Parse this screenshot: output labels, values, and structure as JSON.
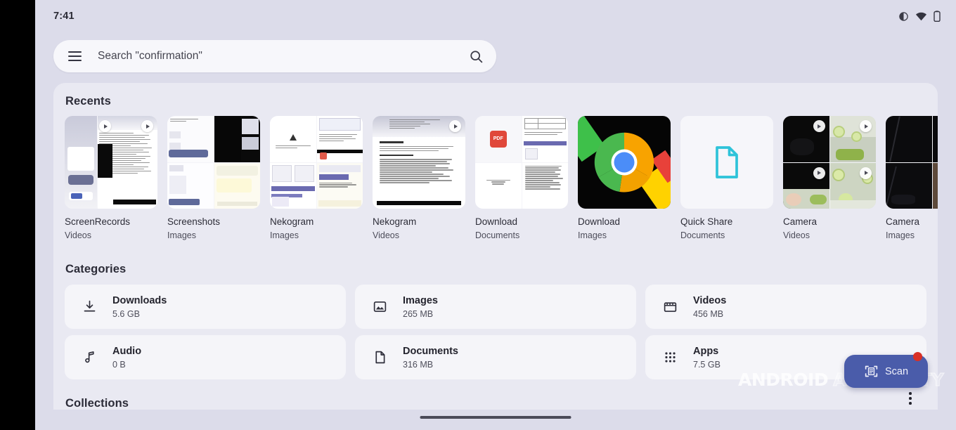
{
  "status_bar": {
    "time": "7:41",
    "icons": [
      "contrast-icon",
      "wifi-icon",
      "battery-icon"
    ]
  },
  "search": {
    "menu_icon": "hamburger-menu-icon",
    "placeholder": "Search \"confirmation\"",
    "search_icon": "search-icon"
  },
  "recents": {
    "title": "Recents",
    "items": [
      {
        "label": "ScreenRecords",
        "type": "Videos",
        "thumb": "screenrecords",
        "has_play": true
      },
      {
        "label": "Screenshots",
        "type": "Images",
        "thumb": "screenshots",
        "has_play": false
      },
      {
        "label": "Nekogram",
        "type": "Images",
        "thumb": "nekogram-img",
        "has_play": false
      },
      {
        "label": "Nekogram",
        "type": "Videos",
        "thumb": "nekogram-vid",
        "has_play": true
      },
      {
        "label": "Download",
        "type": "Documents",
        "thumb": "download-doc",
        "has_play": false
      },
      {
        "label": "Download",
        "type": "Images",
        "thumb": "chrome-logo",
        "has_play": false
      },
      {
        "label": "Quick Share",
        "type": "Documents",
        "thumb": "quickshare-doc",
        "has_play": false
      },
      {
        "label": "Camera",
        "type": "Videos",
        "thumb": "camera-vid",
        "has_play": true
      },
      {
        "label": "Camera",
        "type": "Images",
        "thumb": "camera-img",
        "has_play": false
      }
    ]
  },
  "categories": {
    "title": "Categories",
    "items": [
      {
        "name": "Downloads",
        "size": "5.6 GB",
        "icon": "download-icon"
      },
      {
        "name": "Images",
        "size": "265 MB",
        "icon": "image-icon"
      },
      {
        "name": "Videos",
        "size": "456 MB",
        "icon": "video-clapper-icon"
      },
      {
        "name": "Audio",
        "size": "0 B",
        "icon": "music-note-icon"
      },
      {
        "name": "Documents",
        "size": "316 MB",
        "icon": "document-icon"
      },
      {
        "name": "Apps",
        "size": "7.5 GB",
        "icon": "apps-grid-icon"
      }
    ]
  },
  "collections": {
    "title": "Collections"
  },
  "scan_fab": {
    "label": "Scan",
    "icon": "document-scan-icon",
    "badge": "notification-dot",
    "color": "#4a5caa"
  },
  "overflow": {
    "icon": "more-vertical-icon"
  },
  "watermark": {
    "word1": "ANDROID",
    "word2": "AUTHORITY"
  },
  "nav": {
    "pill": "gesture-nav-pill"
  },
  "colors": {
    "page_bg": "#dcdcea",
    "panel_bg": "#e9e9f2",
    "card_bg": "#f5f5f9",
    "accent": "#4a5caa",
    "quickshare_icon": "#2ec3d9"
  }
}
